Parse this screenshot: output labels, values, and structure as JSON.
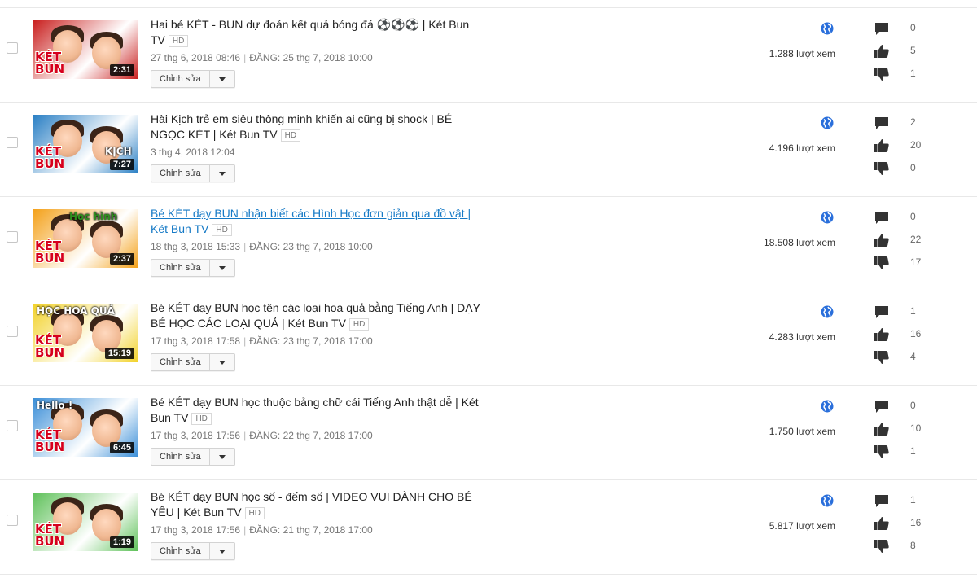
{
  "videos": [
    {
      "title": "Hai bé KÉT - BUN dự đoán kết quả bóng đá ⚽⚽⚽ | Két Bun TV",
      "hd": "HD",
      "date": "27 thg 6, 2018 08:46",
      "published": "ĐĂNG: 25 thg 7, 2018 10:00",
      "duration": "2:31",
      "thumb_word1": "KÉT",
      "thumb_word2": "BUN",
      "thumb_tag": "",
      "edit_label": "Chỉnh sửa",
      "views": "1.288 lượt xem",
      "comments": "0",
      "likes": "5",
      "dislikes": "1",
      "link": false
    },
    {
      "title": "Hài Kịch trẻ em siêu thông minh khiến ai cũng bị shock | BÉ NGỌC KÉT | Két Bun TV",
      "hd": "HD",
      "date": "3 thg 4, 2018 12:04",
      "published": "",
      "duration": "7:27",
      "thumb_word1": "KÉT",
      "thumb_word2": "BUN",
      "thumb_tag": "KỊCH",
      "edit_label": "Chỉnh sửa",
      "views": "4.196 lượt xem",
      "comments": "2",
      "likes": "20",
      "dislikes": "0",
      "link": false
    },
    {
      "title": "Bé KÉT dạy BUN nhận biết các Hình Học đơn giản qua đồ vật | Két Bun TV",
      "hd": "HD",
      "date": "18 thg 3, 2018 15:33",
      "published": "ĐĂNG: 23 thg 7, 2018 10:00",
      "duration": "2:37",
      "thumb_word1": "KÉT",
      "thumb_word2": "BUN",
      "thumb_tag": "Học hình",
      "edit_label": "Chỉnh sửa",
      "views": "18.508 lượt xem",
      "comments": "0",
      "likes": "22",
      "dislikes": "17",
      "link": true
    },
    {
      "title": "Bé KÉT dạy BUN học tên các loại hoa quả bằng Tiếng Anh | DẠY BÉ HỌC CÁC LOẠI QUẢ | Két Bun TV",
      "hd": "HD",
      "date": "17 thg 3, 2018 17:58",
      "published": "ĐĂNG: 23 thg 7, 2018 17:00",
      "duration": "15:19",
      "thumb_word1": "KÉT",
      "thumb_word2": "BUN",
      "thumb_tag": "HỌC HOA QUẢ",
      "edit_label": "Chỉnh sửa",
      "views": "4.283 lượt xem",
      "comments": "1",
      "likes": "16",
      "dislikes": "4",
      "link": false
    },
    {
      "title": "Bé KÉT dạy BUN học thuộc bảng chữ cái Tiếng Anh thật dễ | Két Bun TV",
      "hd": "HD",
      "date": "17 thg 3, 2018 17:56",
      "published": "ĐĂNG: 22 thg 7, 2018 17:00",
      "duration": "6:45",
      "thumb_word1": "KÉT",
      "thumb_word2": "BUN",
      "thumb_tag": "Hello !",
      "edit_label": "Chỉnh sửa",
      "views": "1.750 lượt xem",
      "comments": "0",
      "likes": "10",
      "dislikes": "1",
      "link": false
    },
    {
      "title": "Bé KÉT dạy BUN học số - đếm số | VIDEO VUI DÀNH CHO BÉ YÊU | Két Bun TV",
      "hd": "HD",
      "date": "17 thg 3, 2018 17:56",
      "published": "ĐĂNG: 21 thg 7, 2018 17:00",
      "duration": "1:19",
      "thumb_word1": "KÉT",
      "thumb_word2": "BUN",
      "thumb_tag": "",
      "edit_label": "Chỉnh sửa",
      "views": "5.817 lượt xem",
      "comments": "1",
      "likes": "16",
      "dislikes": "8",
      "link": false
    }
  ],
  "thumb_backgrounds": [
    "#c9201f",
    "#2a7fc4",
    "#f4a11a",
    "#f2d22a",
    "#3c8fd8",
    "#5fc15a"
  ],
  "colors": {
    "link": "#167ac6",
    "globe": "#2a6fdb",
    "icon": "#333333",
    "divider": "#e8e8e8"
  },
  "icons": {
    "visibility": "globe-icon",
    "comments": "comment-icon",
    "likes": "thumbs-up-icon",
    "dislikes": "thumbs-down-icon",
    "dropdown": "caret-down-icon"
  }
}
